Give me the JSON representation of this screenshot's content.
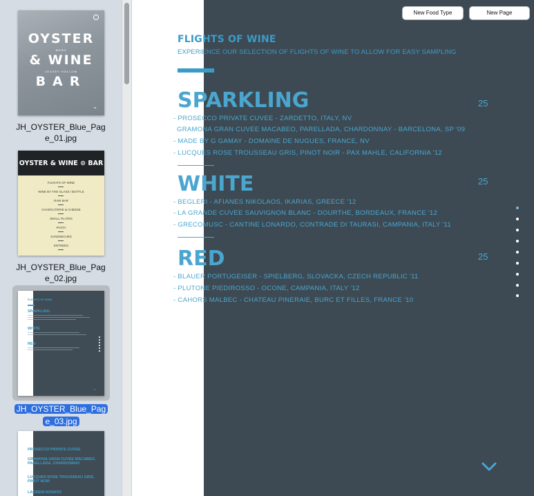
{
  "sidebar": {
    "pages": [
      {
        "label": "JH_OYSTER_Blue_Page_01.jpg",
        "label_lines": [
          "JH_OYSTER_Blue_Pag",
          "e_01.jpg"
        ],
        "cover": {
          "line1": "OYSTER",
          "line2": "& WINE",
          "line3": "BAR",
          "tag1": "MENU",
          "tag2": "JOCKEY HOLLOW"
        }
      },
      {
        "label": "JH_OYSTER_Blue_Page_02.jpg",
        "label_lines": [
          "JH_OYSTER_Blue_Pag",
          "e_02.jpg"
        ],
        "header": "OYSTER & WINE ⊙ BAR",
        "menu_items": [
          "FLIGHTS OF WINE",
          "WINE BY THE GLASS / BOTTLE",
          "RAW BAR",
          "CHARCUTERIE & CHEESE",
          "SMALL PLATES",
          "PASTA",
          "SANDWICHES",
          "ENTREES"
        ]
      },
      {
        "label": "JH_OYSTER_Blue_Page_03.jpg",
        "label_lines": [
          "JH_OYSTER_Blue_Pag",
          "e_03.jpg"
        ],
        "selected": true,
        "mini": {
          "title": "FLIGHTS OF WINE",
          "s1": "SPARKLING",
          "s2": "WHITE",
          "s3": "RED"
        }
      },
      {
        "label": "",
        "mini": {
          "l1": "PROSECCO PRIVATE CUVEE",
          "l2": "GRAMONA GRAN CUVEE MACABEO, PARELLADA, CHARDONNAY",
          "l3": "LUCQUES ROSE TROUSSEAU GRIS, PINOT NOIR",
          "l4": "LACREIN ROSATO"
        }
      }
    ]
  },
  "toolbar": {
    "new_food_type": "New Food Type",
    "new_page": "New Page"
  },
  "page": {
    "title": "FLIGHTS OF WINE",
    "subtitle": "EXPERIENCE OUR SELECTION OF FLIGHTS OF WINE TO ALLOW FOR EASY SAMPLING",
    "sections": [
      {
        "name": "SPARKLING",
        "price": "25",
        "items": [
          "- PROSECCO PRIVATE CUVEE - ZARDETTO, ITALY, NV",
          "GRAMONA GRAN CUVEE MACABEO, PARELLADA, CHARDONNAY - BARCELONA, SP '09",
          "- MADE BY G GAMAY - DOMAINE DE NUGUES, FRANCE, NV",
          "- LUCQUES ROSE TROUSSEAU GRIS, PINOT NOIR - PAX MAHLE, CALIFORNIA '12"
        ]
      },
      {
        "name": "WHITE",
        "price": "25",
        "items": [
          "- BEGLERI - AFIANES NIKOLAOS, IKARIAS, GREECE '12",
          "- LA GRANDE CUVEE SAUVIGNON BLANC - DOURTHE, BORDEAUX, FRANCE '12",
          "- GRECOMUSC - CANTINE LONARDO, CONTRADE DI TAURASI, CAMPANIA, ITALY '11"
        ]
      },
      {
        "name": "RED",
        "price": "25",
        "items": [
          "- BLAUER PORTUGEISER - SPIELBERG, SLOVACKA, CZECH REPUBLIC '11",
          "- PLUTONE PIEDIROSSO - OCONE, CAMPANIA, ITALY '12",
          "- CAHORS MALBEC - CHATEAU PINERAIE, BURC ET FILLES, FRANCE '10"
        ]
      }
    ],
    "page_dots": 9,
    "active_dot": 0
  },
  "colors": {
    "accent": "#4aa6cf",
    "page_bg": "#3d4a53",
    "selection": "#2e6fe0"
  }
}
